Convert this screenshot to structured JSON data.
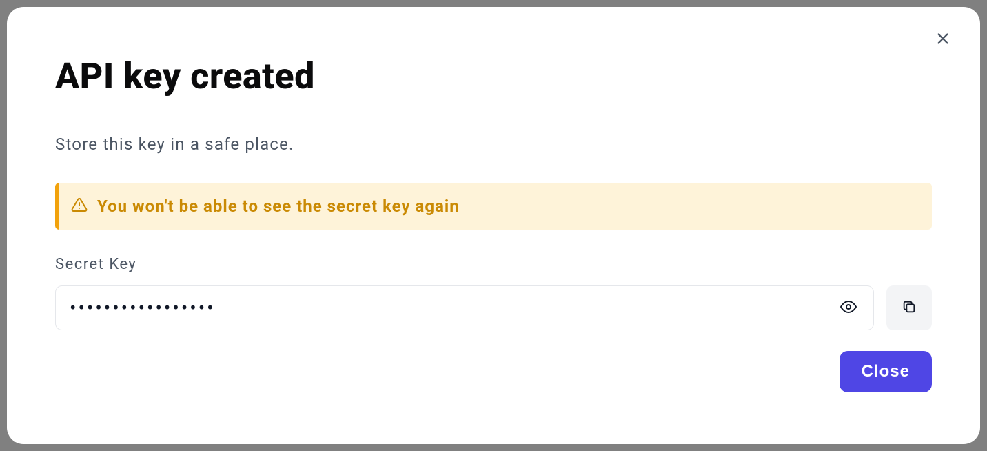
{
  "modal": {
    "title": "API key created",
    "subtitle": "Store this key in a safe place.",
    "alert_text": "You won't be able to see the secret key again",
    "field_label": "Secret Key",
    "key_value": "•••••••••••••••••",
    "close_button_label": "Close"
  }
}
